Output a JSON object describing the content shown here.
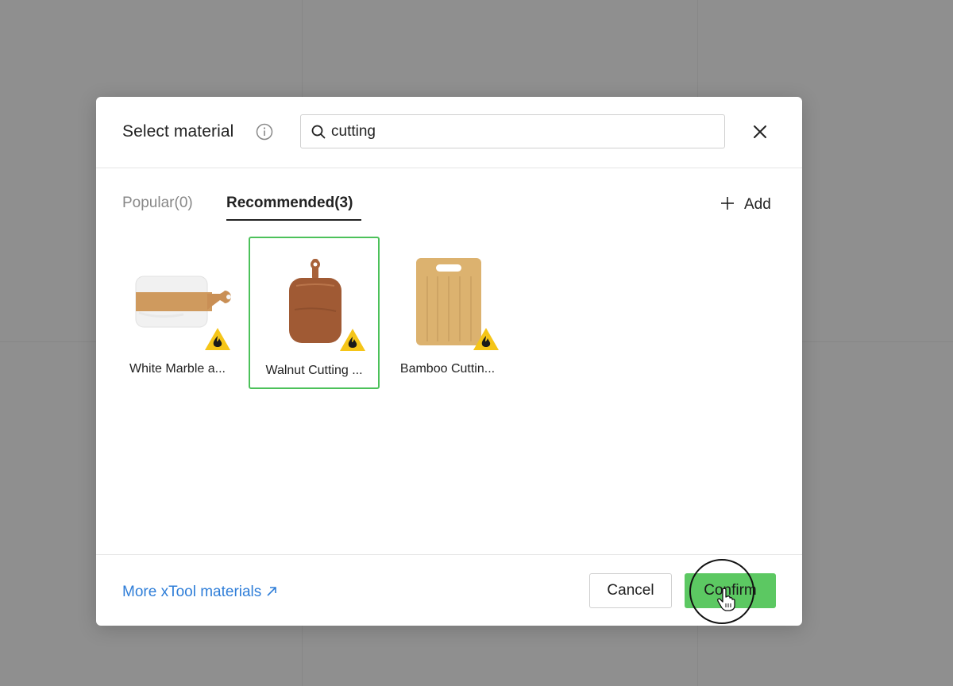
{
  "dialog": {
    "title": "Select material",
    "search": {
      "value": "cutting",
      "placeholder": ""
    }
  },
  "tabs": [
    {
      "label": "Popular(0)",
      "active": false
    },
    {
      "label": "Recommended(3)",
      "active": true
    }
  ],
  "add_label": "Add",
  "materials": [
    {
      "label": "White Marble a...",
      "selected": false,
      "warning_icon": "flame-warning-icon"
    },
    {
      "label": "Walnut Cutting ...",
      "selected": true,
      "warning_icon": "flame-warning-icon"
    },
    {
      "label": "Bamboo Cuttin...",
      "selected": false,
      "warning_icon": "flame-warning-icon"
    }
  ],
  "footer": {
    "more_link": "More xTool materials",
    "cancel_label": "Cancel",
    "confirm_label": "Confirm"
  },
  "colors": {
    "accent_green": "#5cc862",
    "selected_border": "#4cc15a",
    "link_blue": "#2f7ed8",
    "warning_yellow": "#f5c518"
  }
}
